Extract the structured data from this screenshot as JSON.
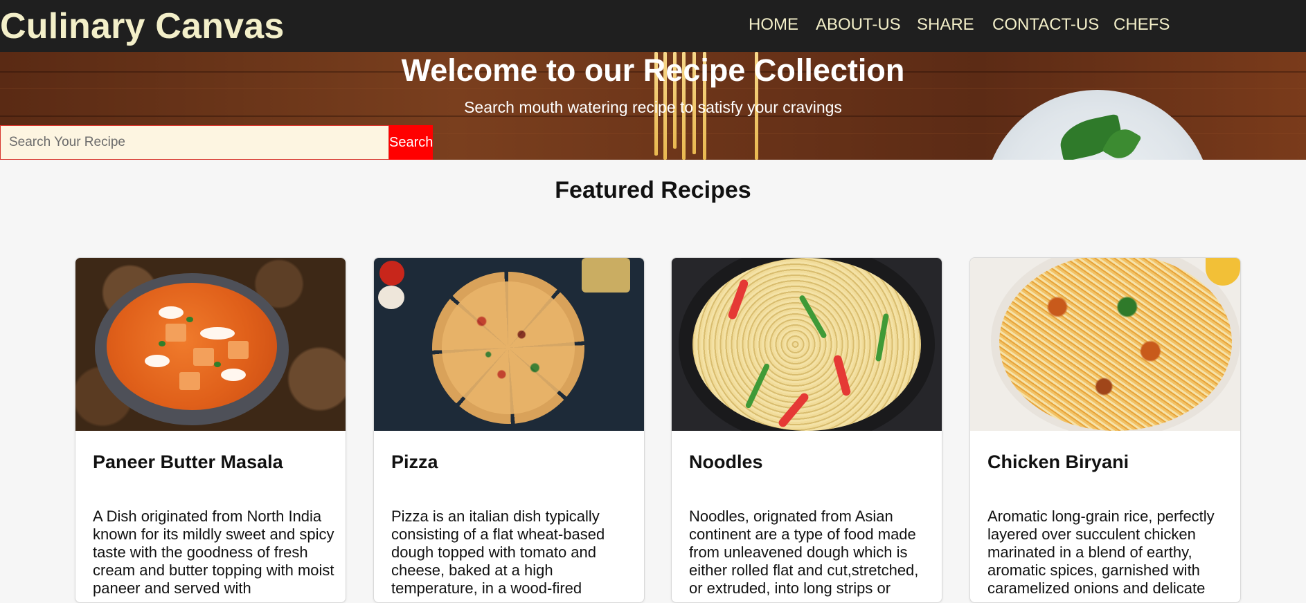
{
  "brand": "Culinary Canvas",
  "nav": {
    "items": [
      {
        "label": "HOME"
      },
      {
        "label": "ABOUT-US"
      },
      {
        "label": "SHARE"
      },
      {
        "label": "CONTACT-US"
      },
      {
        "label": "CHEFS"
      }
    ]
  },
  "hero": {
    "title": "Welcome to our Recipe Collection",
    "subtitle": "Search mouth watering recipe to satisfy your cravings",
    "search": {
      "placeholder": "Search Your Recipe",
      "value": "",
      "button_label": "Search"
    }
  },
  "featured": {
    "title": "Featured Recipes",
    "recipes": [
      {
        "title": "Paneer Butter Masala",
        "description": "A Dish originated from North India known for its mildly sweet and spicy taste with the goodness of fresh cream and butter topping with moist paneer and served with",
        "image": "paneer-butter-masala-image"
      },
      {
        "title": "Pizza",
        "description": "Pizza is an italian dish typically consisting of a flat wheat-based dough topped with tomato and cheese, baked at a high temperature, in a wood-fired",
        "image": "pizza-image"
      },
      {
        "title": "Noodles",
        "description": "Noodles, orignated from Asian continent are a type of food made from unleavened dough which is either rolled flat and cut,stretched, or extruded, into long strips or",
        "image": "noodles-image"
      },
      {
        "title": "Chicken Biryani",
        "description": "Aromatic long-grain rice, perfectly layered over succulent chicken marinated in a blend of earthy, aromatic spices, garnished with caramelized onions and delicate",
        "image": "chicken-biryani-image"
      }
    ]
  },
  "colors": {
    "navbar_bg": "#1f1f1f",
    "brand_text": "#f3efc9",
    "search_button": "#ff0000",
    "search_input_bg": "#fdf5e1",
    "page_bg": "#f6f6f6"
  }
}
